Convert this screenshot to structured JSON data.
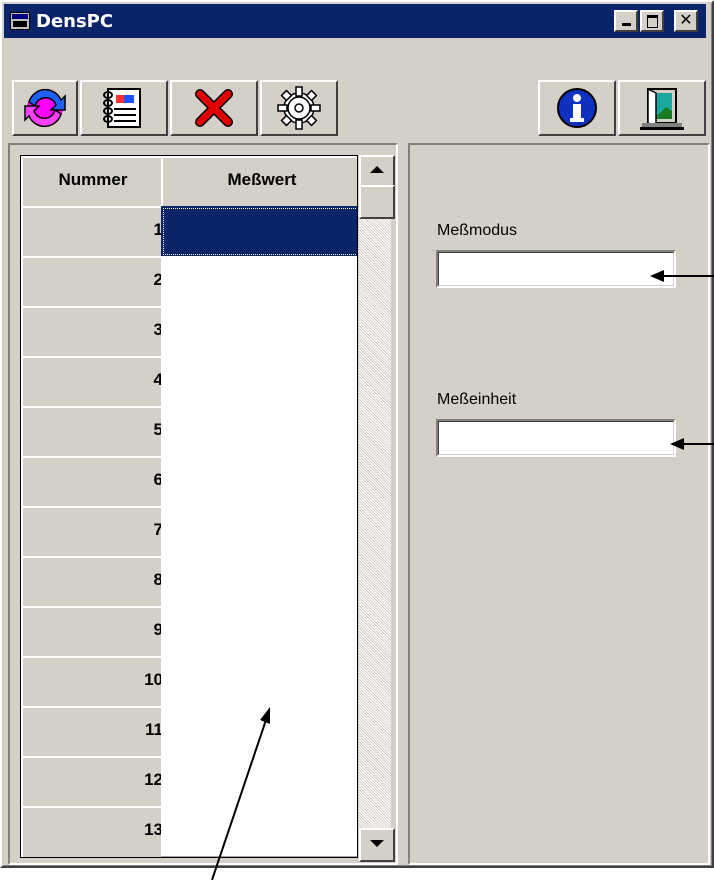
{
  "window": {
    "title": "DensPC"
  },
  "titlebar_buttons": {
    "minimize": "_",
    "maximize": "□",
    "close": "✕"
  },
  "toolbar": {
    "left_buttons": [
      {
        "name": "refresh-button",
        "icon": "refresh-arrows-icon"
      },
      {
        "name": "notebook-button",
        "icon": "notebook-icon"
      },
      {
        "name": "delete-button",
        "icon": "red-x-icon"
      },
      {
        "name": "settings-button",
        "icon": "gear-icon"
      }
    ],
    "right_buttons": [
      {
        "name": "info-button",
        "icon": "info-icon"
      },
      {
        "name": "exit-button",
        "icon": "exit-door-icon"
      }
    ]
  },
  "table": {
    "columns": [
      "Nummer",
      "Meßwert"
    ],
    "rows": [
      {
        "nummer": "1",
        "messwert": ""
      },
      {
        "nummer": "2",
        "messwert": ""
      },
      {
        "nummer": "3",
        "messwert": ""
      },
      {
        "nummer": "4",
        "messwert": ""
      },
      {
        "nummer": "5",
        "messwert": ""
      },
      {
        "nummer": "6",
        "messwert": ""
      },
      {
        "nummer": "7",
        "messwert": ""
      },
      {
        "nummer": "8",
        "messwert": ""
      },
      {
        "nummer": "9",
        "messwert": ""
      },
      {
        "nummer": "10",
        "messwert": ""
      },
      {
        "nummer": "11",
        "messwert": ""
      },
      {
        "nummer": "12",
        "messwert": ""
      },
      {
        "nummer": "13",
        "messwert": ""
      }
    ],
    "selected_row": 1
  },
  "right_panel": {
    "messmodus_label": "Meßmodus",
    "messmodus_value": "",
    "messeinheit_label": "Meßeinheit",
    "messeinheit_value": ""
  },
  "colors": {
    "titlebar": "#0a246a",
    "face": "#d4d0c8",
    "selection": "#0a246a"
  }
}
